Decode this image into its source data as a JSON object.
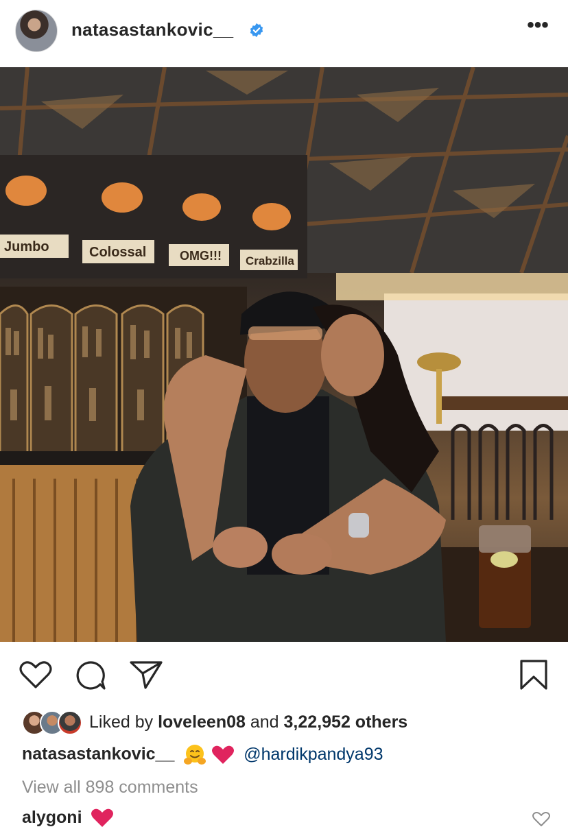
{
  "post": {
    "username": "natasastankovic__",
    "more_label": "•••",
    "photo_signs": [
      "Jumbo",
      "Colossal",
      "OMG!!!",
      "Crabzilla"
    ]
  },
  "icons": {
    "verified": "verified-badge-icon",
    "like": "heart-icon",
    "comment": "comment-bubble-icon",
    "share": "paper-plane-icon",
    "save": "bookmark-icon"
  },
  "likes": {
    "prefix": "Liked by ",
    "user": "loveleen08",
    "middle": " and ",
    "count_text": "3,22,952 others"
  },
  "caption": {
    "username": "natasastankovic__",
    "mention": "@hardikpandya93"
  },
  "comments": {
    "view_all": "View all 898 comments",
    "items": [
      {
        "username": "alygoni"
      }
    ]
  },
  "colors": {
    "verified_blue": "#3897f0",
    "mention_blue": "#00376b",
    "heart_red": "#e0245e",
    "muted_gray": "#8e8e8e"
  }
}
